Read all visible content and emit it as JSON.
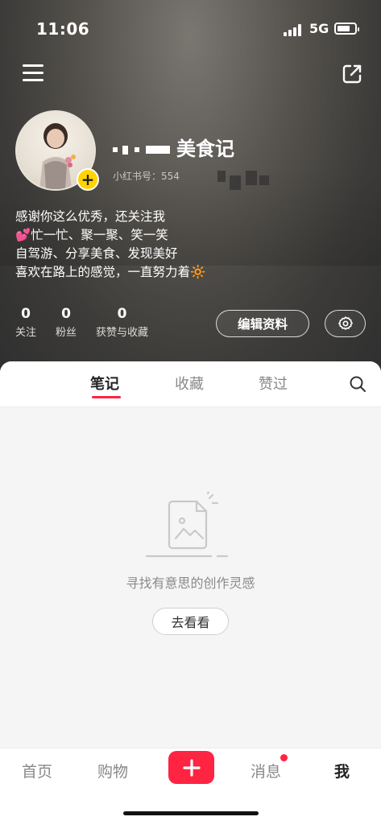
{
  "status_bar": {
    "time": "11:06",
    "network": "5G"
  },
  "profile": {
    "username_visible": "美食记",
    "user_id_label": "小红书号：554",
    "bio_lines": [
      "感谢你这么优秀，还关注我",
      "💕忙一忙、聚一聚、笑一笑",
      "自驾游、分享美食、发现美好",
      "喜欢在路上的感觉，一直努力着🔆"
    ],
    "stats": [
      {
        "value": "0",
        "label": "关注"
      },
      {
        "value": "0",
        "label": "粉丝"
      },
      {
        "value": "0",
        "label": "获赞与收藏"
      }
    ],
    "edit_button": "编辑资料"
  },
  "tabs": [
    {
      "label": "笔记",
      "active": true
    },
    {
      "label": "收藏",
      "active": false
    },
    {
      "label": "赞过",
      "active": false
    }
  ],
  "empty_state": {
    "text": "寻找有意思的创作灵感",
    "button": "去看看"
  },
  "bottom_nav": {
    "items": [
      {
        "label": "首页"
      },
      {
        "label": "购物"
      },
      {
        "label": "消息"
      },
      {
        "label": "我"
      }
    ]
  },
  "colors": {
    "accent": "#ff2442",
    "badge": "#ffd400"
  },
  "icons": [
    "menu-icon",
    "share-icon",
    "add-icon",
    "settings-icon",
    "search-icon",
    "empty-image-icon"
  ]
}
